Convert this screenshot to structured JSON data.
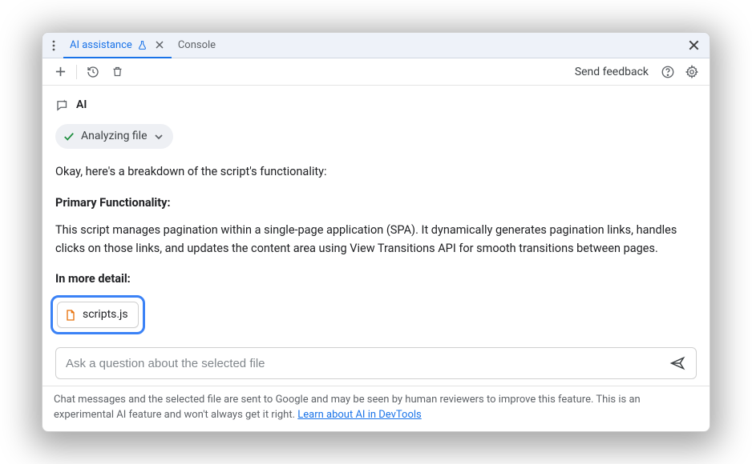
{
  "tabs": {
    "ai_label": "AI assistance",
    "console_label": "Console"
  },
  "toolbar": {
    "feedback_label": "Send feedback"
  },
  "ai": {
    "header_label": "AI",
    "status_label": "Analyzing file"
  },
  "response": {
    "intro": "Okay, here's a breakdown of the script's functionality:",
    "primary_heading": "Primary Functionality:",
    "primary_body": "This script manages pagination within a single-page application (SPA). It dynamically generates pagination links, handles clicks on those links, and updates the content area using View Transitions API for smooth transitions between pages.",
    "detail_heading": "In more detail:"
  },
  "selected_file": {
    "name": "scripts.js"
  },
  "prompt": {
    "placeholder": "Ask a question about the selected file"
  },
  "footer": {
    "text_before_link": "Chat messages and the selected file are sent to Google and may be seen by human reviewers to improve this feature. This is an experimental AI feature and won't always get it right. ",
    "link_text": "Learn about AI in DevTools"
  }
}
